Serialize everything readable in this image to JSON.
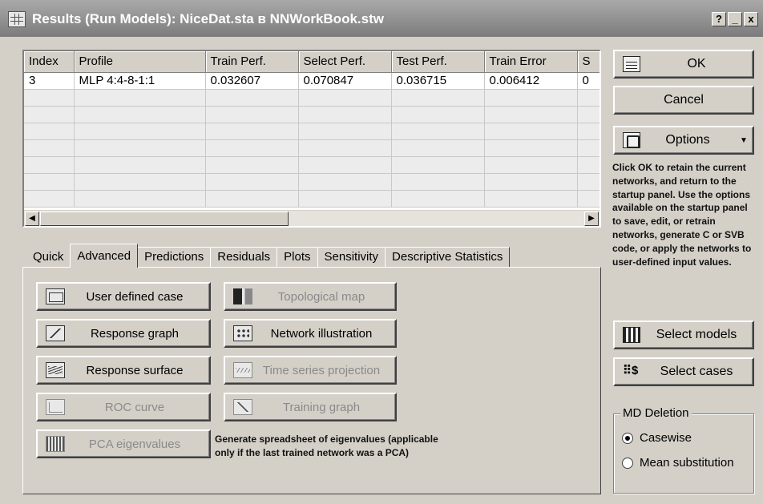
{
  "window": {
    "title": "Results (Run Models): NiceDat.sta в NNWorkBook.stw",
    "help_label": "?",
    "minimize_label": "_",
    "close_label": "x"
  },
  "grid": {
    "columns": [
      "Index",
      "Profile",
      "Train Perf.",
      "Select Perf.",
      "Test Perf.",
      "Train Error",
      "S"
    ],
    "rows": [
      [
        "3",
        "MLP 4:4-8-1:1",
        "0.032607",
        "0.070847",
        "0.036715",
        "0.006412",
        "0"
      ]
    ],
    "scroll_left_label": "◀",
    "scroll_right_label": "▶"
  },
  "tabs": [
    {
      "label": "Quick"
    },
    {
      "label": "Advanced"
    },
    {
      "label": "Predictions"
    },
    {
      "label": "Residuals"
    },
    {
      "label": "Plots"
    },
    {
      "label": "Sensitivity"
    },
    {
      "label": "Descriptive Statistics"
    }
  ],
  "advanced": {
    "user_defined_case": "User defined case",
    "response_graph": "Response graph",
    "response_surface": "Response surface",
    "roc_curve": "ROC curve",
    "pca_eigenvalues": "PCA eigenvalues",
    "topological_map": "Topological map",
    "network_illustration": "Network illustration",
    "time_series_projection": "Time series projection",
    "training_graph": "Training graph",
    "pca_note": "Generate spreadsheet of eigenvalues (applicable only if the last trained network was a PCA)"
  },
  "right_panel": {
    "ok": "OK",
    "cancel": "Cancel",
    "options": "Options",
    "options_arrow": "▼",
    "help_text": "Click OK to retain the current networks, and return to the startup panel. Use the options available on the startup panel to save, edit, or retrain networks, generate C or SVB code, or apply the networks to user-defined input values.",
    "select_models": "Select models",
    "select_cases": "Select cases",
    "select_cases_icon_text": "⠿$"
  },
  "md_deletion": {
    "title": "MD Deletion",
    "options": [
      {
        "label": "Casewise",
        "selected": true
      },
      {
        "label": "Mean substitution",
        "selected": false
      }
    ]
  }
}
